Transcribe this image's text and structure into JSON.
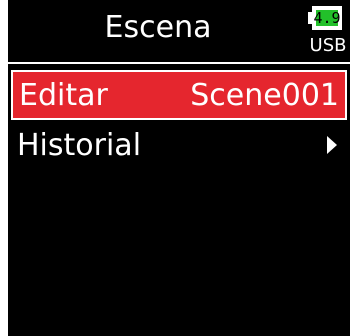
{
  "header": {
    "title": "Escena",
    "battery_level": "4.9",
    "power_source": "USB",
    "battery_color": "#22c02a"
  },
  "menu": {
    "items": [
      {
        "label": "Editar",
        "value": "Scene001",
        "selected": true
      },
      {
        "label": "Historial",
        "value": "",
        "icon": "chevron-right-icon",
        "selected": false
      }
    ]
  },
  "colors": {
    "selection": "#e5262e",
    "background": "#000000",
    "text": "#ffffff"
  }
}
